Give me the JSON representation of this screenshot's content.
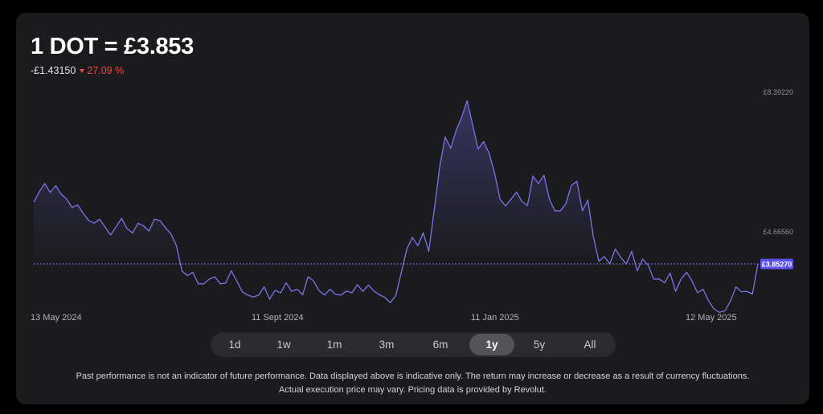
{
  "header": {
    "title": "1 DOT = £3.853",
    "change_abs": "-£1.43150",
    "change_pct": "27.09 %",
    "change_icon": "down-triangle-icon"
  },
  "colors": {
    "background": "#1b1b1e",
    "line": "#7b73e8",
    "negative": "#ef4747",
    "current_badge": "#5b50e8"
  },
  "chart_data": {
    "type": "area",
    "title": "",
    "xlabel": "",
    "ylabel": "",
    "x_range": [
      "2024-05-13",
      "2025-06-12"
    ],
    "x_tick_labels": [
      "13 May 2024",
      "11 Sept 2024",
      "11 Jan 2025",
      "12 May 2025"
    ],
    "y_tick_labels": [
      "£8.39220",
      "£4.66560"
    ],
    "y_ticks": [
      8.3922,
      4.6656
    ],
    "current_value": 3.8527,
    "current_label": "£3.85270",
    "grid": false,
    "legend": "none",
    "series": [
      {
        "values": [
          5.5,
          5.78,
          6.0,
          5.76,
          5.94,
          5.72,
          5.58,
          5.36,
          5.43,
          5.21,
          5.01,
          4.94,
          5.05,
          4.84,
          4.63,
          4.84,
          5.07,
          4.8,
          4.68,
          4.94,
          4.87,
          4.73,
          5.05,
          5.01,
          4.82,
          4.66,
          4.34,
          3.67,
          3.54,
          3.63,
          3.32,
          3.32,
          3.45,
          3.51,
          3.32,
          3.34,
          3.67,
          3.4,
          3.11,
          3.02,
          2.97,
          3.02,
          3.24,
          2.91,
          3.15,
          3.08,
          3.35,
          3.12,
          3.18,
          3.03,
          3.51,
          3.4,
          3.14,
          3.02,
          3.18,
          3.04,
          3.02,
          3.13,
          3.08,
          3.3,
          3.12,
          3.29,
          3.13,
          3.03,
          2.96,
          2.82,
          3.01,
          3.62,
          4.25,
          4.56,
          4.34,
          4.68,
          4.19,
          5.29,
          6.45,
          7.24,
          6.94,
          7.42,
          7.77,
          8.21,
          7.56,
          6.92,
          7.12,
          6.81,
          6.28,
          5.58,
          5.4,
          5.58,
          5.77,
          5.52,
          5.41,
          6.2,
          6.0,
          6.22,
          5.58,
          5.27,
          5.27,
          5.46,
          5.95,
          6.06,
          5.27,
          5.56,
          4.59,
          3.92,
          4.05,
          3.85,
          4.25,
          4.02,
          3.85,
          4.19,
          3.67,
          3.98,
          3.82,
          3.45,
          3.45,
          3.35,
          3.61,
          3.12,
          3.45,
          3.63,
          3.4,
          3.08,
          3.18,
          2.87,
          2.65,
          2.56,
          2.6,
          2.86,
          3.24,
          3.11,
          3.12,
          3.05,
          3.85
        ]
      }
    ]
  },
  "range_selector": {
    "options": [
      "1d",
      "1w",
      "1m",
      "3m",
      "6m",
      "1y",
      "5y",
      "All"
    ],
    "selected": "1y"
  },
  "disclaimer": {
    "line1": "Past performance is not an indicator of future performance. Data displayed above is indicative only. The return may increase or decrease as a result of currency fluctuations.",
    "line2": "Actual execution price may vary. Pricing data is provided by Revolut."
  }
}
